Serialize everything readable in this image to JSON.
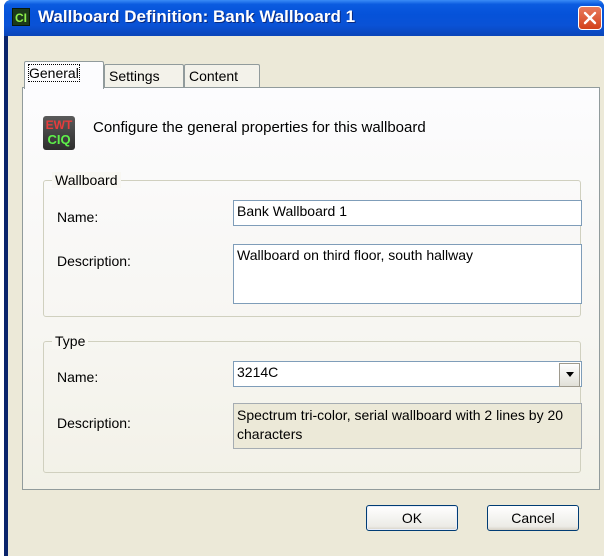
{
  "window": {
    "title": "Wallboard Definition: Bank Wallboard 1",
    "app_icon_text": "CI"
  },
  "tabs": [
    {
      "label": "General",
      "active": true
    },
    {
      "label": "Settings",
      "active": false
    },
    {
      "label": "Content",
      "active": false
    }
  ],
  "header": {
    "icon_top": "EWT",
    "icon_bottom": "CIQ",
    "text": "Configure the general properties for this wallboard"
  },
  "wallboard_group": {
    "legend": "Wallboard",
    "name_label": "Name:",
    "name_value": "Bank Wallboard 1",
    "description_label": "Description:",
    "description_value": "Wallboard on third floor, south hallway"
  },
  "type_group": {
    "legend": "Type",
    "name_label": "Name:",
    "name_value": "3214C",
    "description_label": "Description:",
    "description_value": "Spectrum tri-color, serial wallboard with 2 lines by 20 characters"
  },
  "buttons": {
    "ok": "OK",
    "cancel": "Cancel"
  },
  "colors": {
    "titlebar": "#0552d9",
    "dialog_bg": "#ece9d8",
    "close_button": "#d3421c"
  }
}
